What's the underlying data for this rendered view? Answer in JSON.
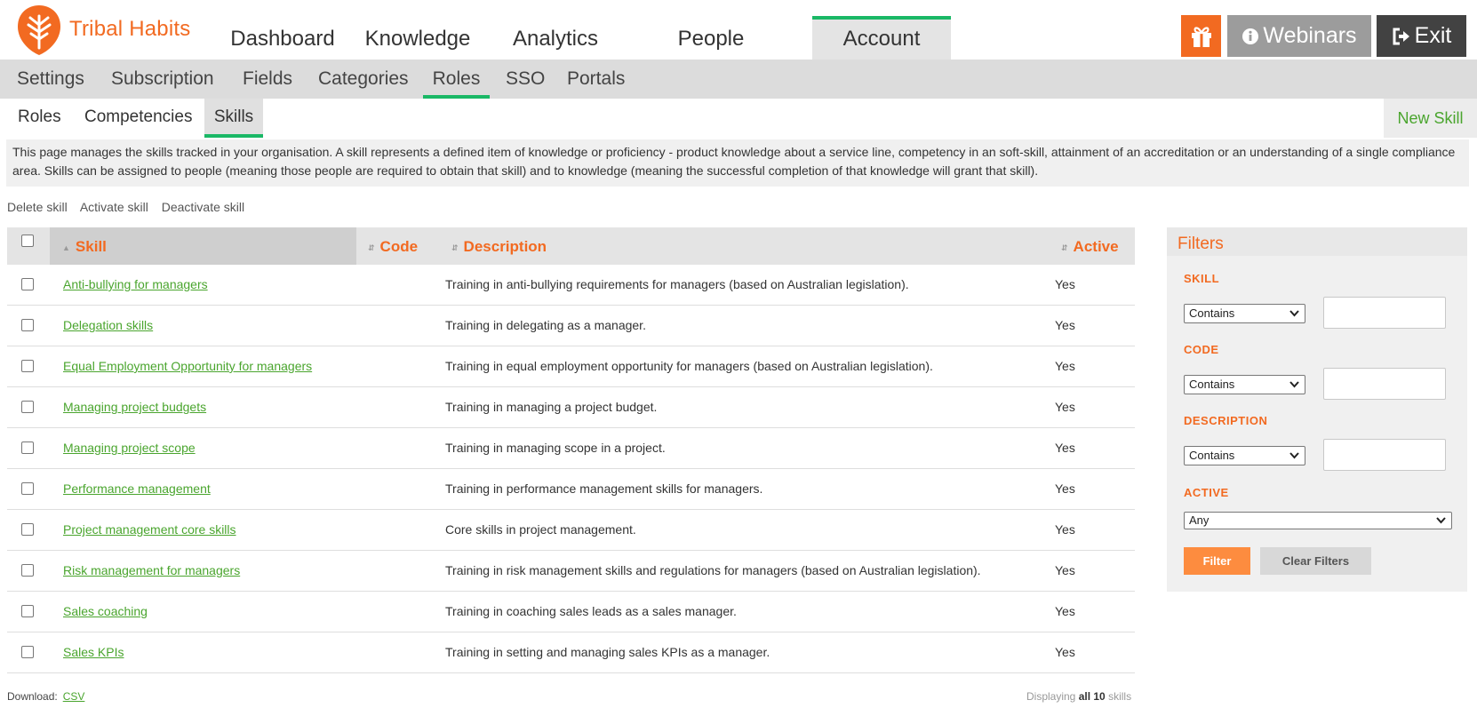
{
  "brand": {
    "name": "Tribal Habits",
    "accent": "#f26a21",
    "green": "#1ab866",
    "link_green": "#4aa52e"
  },
  "main_nav": {
    "items": [
      {
        "label": "Dashboard"
      },
      {
        "label": "Knowledge"
      },
      {
        "label": "Analytics"
      },
      {
        "label": "People"
      },
      {
        "label": "Account",
        "active": true
      }
    ]
  },
  "header_buttons": {
    "gift_icon": "gift-icon",
    "webinars": "Webinars",
    "exit": "Exit"
  },
  "sub_nav": {
    "items": [
      "Settings",
      "Subscription",
      "Fields",
      "Categories",
      "Roles",
      "SSO",
      "Portals"
    ],
    "active": "Roles"
  },
  "tabs": {
    "items": [
      "Roles",
      "Competencies",
      "Skills"
    ],
    "active": "Skills",
    "new_button": "New Skill"
  },
  "info_text": "This page manages the skills tracked in your organisation. A skill represents a defined item of knowledge or proficiency - product knowledge about a service line, competency in an soft-skill, attainment of an accreditation or an understanding of a single compliance area. Skills can be assigned to people (meaning those people are required to obtain that skill) and to knowledge (meaning the successful completion of that knowledge will grant that skill).",
  "actions": [
    "Delete skill",
    "Activate skill",
    "Deactivate skill"
  ],
  "table": {
    "columns": {
      "skill": "Skill",
      "code": "Code",
      "description": "Description",
      "active": "Active"
    },
    "sorted_by": "Skill",
    "rows": [
      {
        "skill": "Anti-bullying for managers",
        "code": "",
        "description": "Training in anti-bullying requirements for managers (based on Australian legislation).",
        "active": "Yes"
      },
      {
        "skill": "Delegation skills",
        "code": "",
        "description": "Training in delegating as a manager.",
        "active": "Yes"
      },
      {
        "skill": "Equal Employment Opportunity for managers",
        "code": "",
        "description": "Training in equal employment opportunity for managers (based on Australian legislation).",
        "active": "Yes"
      },
      {
        "skill": "Managing project budgets",
        "code": "",
        "description": "Training in managing a project budget.",
        "active": "Yes"
      },
      {
        "skill": "Managing project scope",
        "code": "",
        "description": "Training in managing scope in a project.",
        "active": "Yes"
      },
      {
        "skill": "Performance management",
        "code": "",
        "description": "Training in performance management skills for managers.",
        "active": "Yes"
      },
      {
        "skill": "Project management core skills",
        "code": "",
        "description": "Core skills in project management.",
        "active": "Yes"
      },
      {
        "skill": "Risk management for managers",
        "code": "",
        "description": "Training in risk management skills and regulations for managers (based on Australian legislation).",
        "active": "Yes"
      },
      {
        "skill": "Sales coaching",
        "code": "",
        "description": "Training in coaching sales leads as a sales manager.",
        "active": "Yes"
      },
      {
        "skill": "Sales KPIs",
        "code": "",
        "description": "Training in setting and managing sales KPIs as a manager.",
        "active": "Yes"
      }
    ]
  },
  "footer": {
    "download_label": "Download:",
    "csv": "CSV",
    "displaying_prefix": "Displaying",
    "displaying_bold": "all 10",
    "displaying_suffix": "skills"
  },
  "filters": {
    "title": "Filters",
    "skill": {
      "label": "SKILL",
      "operator": "Contains",
      "value": ""
    },
    "code": {
      "label": "CODE",
      "operator": "Contains",
      "value": ""
    },
    "description": {
      "label": "DESCRIPTION",
      "operator": "Contains",
      "value": ""
    },
    "active": {
      "label": "ACTIVE",
      "value": "Any"
    },
    "filter_button": "Filter",
    "clear_button": "Clear Filters"
  }
}
